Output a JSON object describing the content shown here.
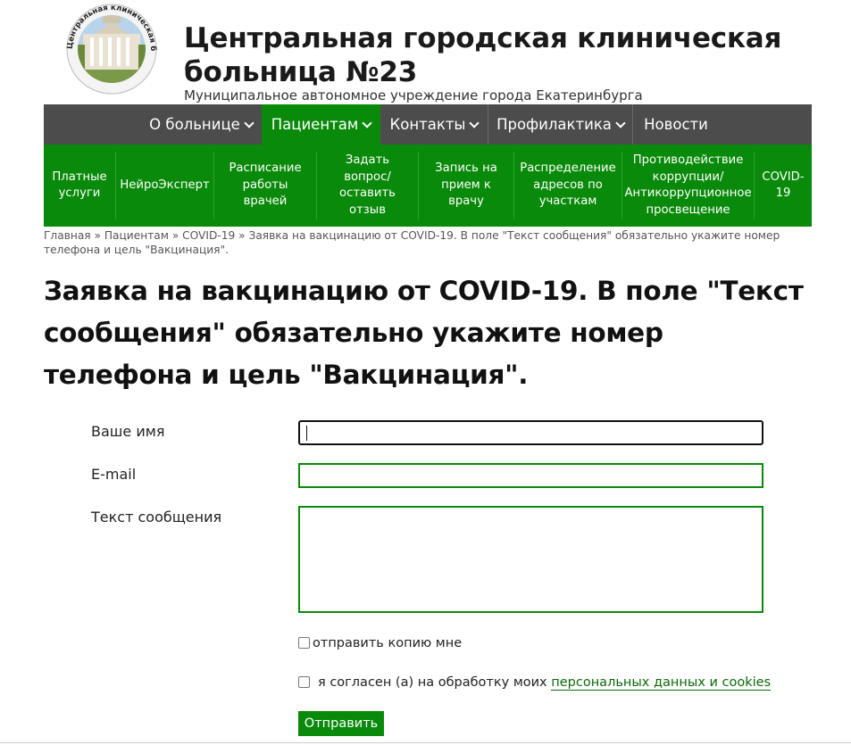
{
  "header": {
    "logo_icon": "hospital-building-seal-icon",
    "logo_seal_text": "Центральная клиническая больница №23",
    "title_line1": "Центральная городская клиническая",
    "title_line2": "больница №23",
    "subtitle": "Муниципальное автономное учреждение города Екатеринбурга"
  },
  "main_nav": [
    {
      "label": "О больнице",
      "dropdown": true,
      "active": false
    },
    {
      "label": "Пациентам",
      "dropdown": true,
      "active": true
    },
    {
      "label": "Контакты",
      "dropdown": true,
      "active": false
    },
    {
      "label": "Профилактика",
      "dropdown": true,
      "active": false
    },
    {
      "label": "Новости",
      "dropdown": false,
      "active": false
    }
  ],
  "sub_nav": [
    {
      "label": "Платные услуги"
    },
    {
      "label": "НейроЭксперт"
    },
    {
      "label": "Расписание работы врачей"
    },
    {
      "label": "Задать вопрос/ оставить отзыв"
    },
    {
      "label": "Запись на прием к врачу"
    },
    {
      "label": "Распределение адресов по участкам"
    },
    {
      "label": "Противодействие коррупции/ Антикоррупционное просвещение"
    },
    {
      "label": "COVID-19"
    }
  ],
  "breadcrumb": {
    "items": [
      "Главная",
      "Пациентам",
      "COVID-19",
      "Заявка на вакцинацию от COVID-19. В поле \"Текст сообщения\" обязательно укажите номер телефона и цель \"Вакцинация\"."
    ],
    "separator": "»"
  },
  "page_title": "Заявка на вакцинацию от COVID-19. В поле \"Текст сообщения\" обязательно укажите номер телефона и цель \"Вакцинация\".",
  "form": {
    "name_label": "Ваше имя",
    "name_value": "",
    "email_label": "E-mail",
    "email_value": "",
    "message_label": "Текст сообщения",
    "message_value": "",
    "copy_label": "отправить копию мне",
    "consent_text": "я согласен (а) на обработку моих",
    "consent_link": "персональных данных и cookies",
    "submit_label": "Отправить"
  },
  "colors": {
    "nav_bg": "#4c4c4c",
    "accent_green": "#0a8a0a"
  }
}
